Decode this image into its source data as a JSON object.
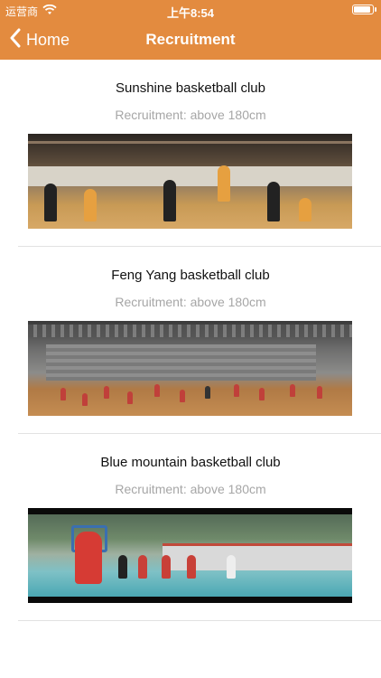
{
  "status_bar": {
    "carrier": "运营商",
    "time": "上午8:54"
  },
  "nav": {
    "back_label": "Home",
    "title": "Recruitment"
  },
  "clubs": [
    {
      "name": "Sunshine basketball club",
      "requirement": "Recruitment: above 180cm"
    },
    {
      "name": "Feng Yang basketball club",
      "requirement": "Recruitment: above 180cm"
    },
    {
      "name": "Blue mountain basketball club",
      "requirement": "Recruitment: above 180cm"
    }
  ],
  "colors": {
    "nav_bar": "#E38B3F",
    "subtitle": "#A6A6A6",
    "separator": "#E2E2E2"
  }
}
